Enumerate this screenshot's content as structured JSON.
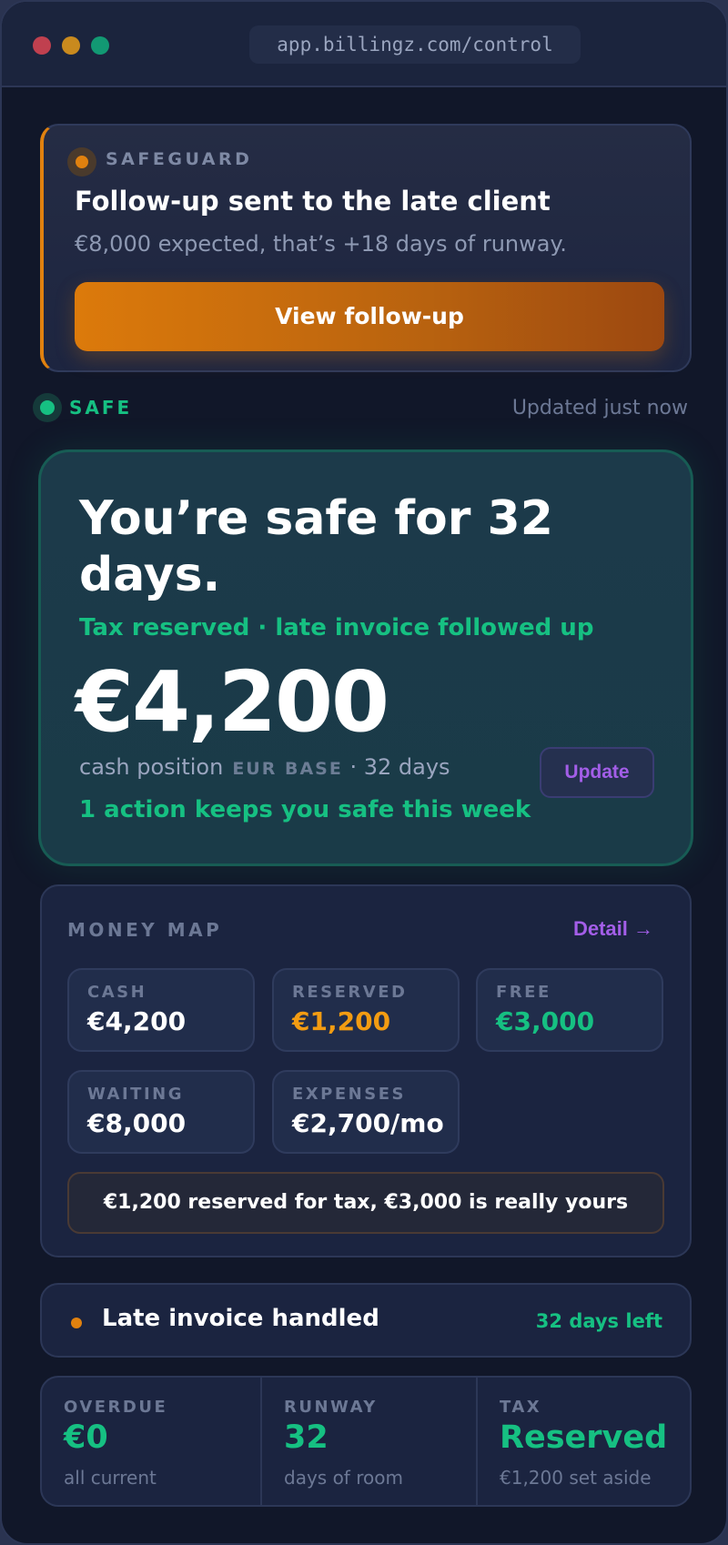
{
  "browser": {
    "url": "app.billingz.com/control"
  },
  "safeguard": {
    "label": "SAFEGUARD",
    "title": "Follow-up sent to the late client",
    "subtitle": "€8,000 expected, that’s +18 days of runway.",
    "button_label": "View follow-up",
    "accent_color": "#e0810f"
  },
  "status": {
    "label": "SAFE",
    "updated": "Updated just now",
    "color": "#16c082"
  },
  "hero": {
    "title": "You’re safe for 32 days.",
    "subtitle": "Tax reserved · late invoice followed up",
    "amount": "€4,200",
    "meta_label": "cash position",
    "base_label": "EUR BASE",
    "days_text": "· 32 days",
    "update_label": "Update",
    "action_text": "1 action keeps you safe this week"
  },
  "money_map": {
    "title": "MONEY MAP",
    "detail_label": "Detail →",
    "tiles": [
      {
        "label": "CASH",
        "value": "€4,200"
      },
      {
        "label": "RESERVED",
        "value": "€1,200"
      },
      {
        "label": "FREE",
        "value": "€3,000"
      },
      {
        "label": "WAITING",
        "value": "€8,000"
      },
      {
        "label": "EXPENSES",
        "value": "€2,700/mo"
      }
    ],
    "note": "€1,200 reserved for tax, €3,000 is really yours"
  },
  "late_invoice": {
    "title": "Late invoice handled",
    "days_left": "32 days left"
  },
  "stats": [
    {
      "label": "OVERDUE",
      "value": "€0",
      "sub": "all current"
    },
    {
      "label": "RUNWAY",
      "value": "32",
      "sub": "days of room"
    },
    {
      "label": "TAX",
      "value": "Reserved",
      "sub": "€1,200 set aside"
    }
  ],
  "icons": {
    "window_controls": [
      "close-dot-icon",
      "minimize-dot-icon",
      "maximize-dot-icon"
    ],
    "safeguard_badge": "alert-dot-icon",
    "status_indicator": "status-dot-icon",
    "late_marker": "bullet-dot-icon"
  }
}
